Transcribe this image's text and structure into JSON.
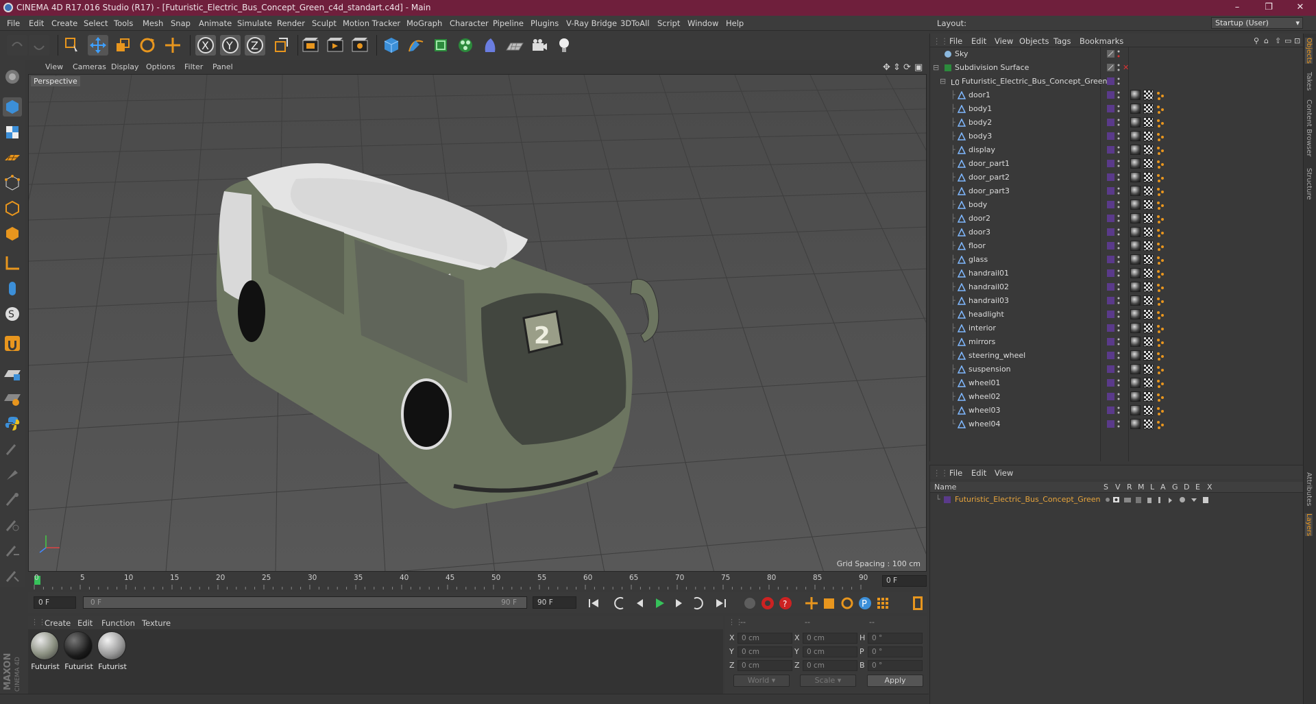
{
  "window": {
    "title": "CINEMA 4D R17.016 Studio (R17) - [Futuristic_Electric_Bus_Concept_Green_c4d_standart.c4d] - Main",
    "minimize": "–",
    "maximize": "❐",
    "close": "✕"
  },
  "menubar": {
    "items": [
      "File",
      "Edit",
      "Create",
      "Select",
      "Tools",
      "Mesh",
      "Snap",
      "Animate",
      "Simulate",
      "Render",
      "Sculpt",
      "Motion Tracker",
      "MoGraph",
      "Character",
      "Pipeline",
      "Plugins",
      "V-Ray Bridge",
      "3DToAll",
      "Script",
      "Window",
      "Help"
    ],
    "layout_label": "Layout:",
    "layout_value": "Startup (User)"
  },
  "viewport": {
    "menu": [
      "View",
      "Cameras",
      "Display",
      "Options",
      "Filter",
      "Panel"
    ],
    "label": "Perspective",
    "grid_spacing": "Grid Spacing : 100 cm",
    "bus_number": "2"
  },
  "timeline": {
    "ticks": [
      "0",
      "5",
      "10",
      "15",
      "20",
      "25",
      "30",
      "35",
      "40",
      "45",
      "50",
      "55",
      "60",
      "65",
      "70",
      "75",
      "80",
      "85",
      "90"
    ],
    "current_frame": "0 F",
    "start_field": "0 F",
    "range_start": "0 F",
    "range_end": "90 F",
    "end_field": "90 F"
  },
  "materials": {
    "menu": [
      "Create",
      "Edit",
      "Function",
      "Texture"
    ],
    "items": [
      "Futurist",
      "Futurist",
      "Futurist"
    ]
  },
  "coords": {
    "header": [
      "--",
      "--",
      "--"
    ],
    "pos": {
      "x": "0 cm",
      "y": "0 cm",
      "z": "0 cm"
    },
    "size": {
      "x": "0 cm",
      "y": "0 cm",
      "z": "0 cm"
    },
    "rot": {
      "h": "0 °",
      "p": "0 °",
      "b": "0 °"
    },
    "labels": {
      "x": "X",
      "y": "Y",
      "z": "Z",
      "h": "H",
      "p": "P",
      "b": "B"
    },
    "world": "World",
    "scale": "Scale",
    "apply": "Apply"
  },
  "objects": {
    "menu": [
      "File",
      "Edit",
      "View",
      "Objects",
      "Tags",
      "Bookmarks"
    ],
    "top": [
      {
        "name": "Sky",
        "icon": "sky-icon"
      },
      {
        "name": "Subdivision Surface",
        "icon": "subdivision-icon"
      },
      {
        "name": "Futuristic_Electric_Bus_Concept_Green",
        "icon": "null-icon"
      }
    ],
    "children": [
      "door1",
      "body1",
      "body2",
      "body3",
      "display",
      "door_part1",
      "door_part2",
      "door_part3",
      "body",
      "door2",
      "door3",
      "floor",
      "glass",
      "handrail01",
      "handrail02",
      "handrail03",
      "headlight",
      "interior",
      "mirrors",
      "steering_wheel",
      "suspension",
      "wheel01",
      "wheel02",
      "wheel03",
      "wheel04"
    ]
  },
  "layers": {
    "menu": [
      "File",
      "Edit",
      "View"
    ],
    "columns": [
      "Name",
      "S",
      "V",
      "R",
      "M",
      "L",
      "A",
      "G",
      "D",
      "E",
      "X"
    ],
    "row_name": "Futuristic_Electric_Bus_Concept_Green",
    "layer_color": "#5a3a8a"
  },
  "sidetabs": [
    "Objects",
    "Takes",
    "Content Browser",
    "Structure",
    "Attributes",
    "Layers"
  ],
  "branding": {
    "maxon": "MAXON",
    "c4d": "CINEMA 4D"
  },
  "colors": {
    "titlebar": "#6f1f3c",
    "accent_orange": "#e8961e",
    "object_name": "#dcdcdc",
    "layer_name": "#e8a53c"
  }
}
